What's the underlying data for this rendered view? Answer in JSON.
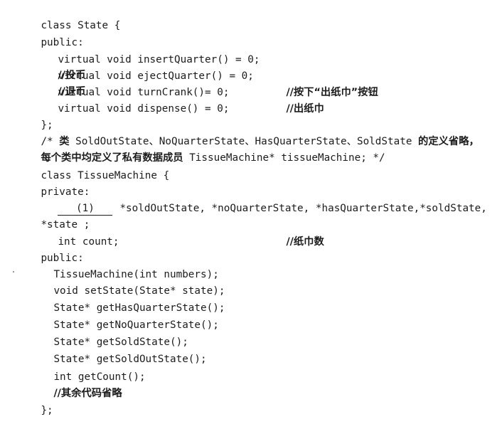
{
  "code": {
    "l01": "class State {",
    "l02": "public:",
    "l03_code": "virtual void insertQuarter() = 0;",
    "l03_comment": "//投币",
    "l04_code": "virtual void ejectQuarter() = 0;",
    "l04_comment": "//退币",
    "l05_code": "virtual void turnCrank()= 0;",
    "l05_comment": "//按下“出纸巾”按钮",
    "l06_code": "virtual void dispense() = 0;",
    "l06_comment": "//出纸巾",
    "l07": "};",
    "l08_a": "/* ",
    "l08_b": "类",
    "l08_c": " SoldOutState、NoQuarterState、HasQuarterState、SoldState ",
    "l08_d": "的定义省略，",
    "l09_a": "每个类中均定义了私有数据成员",
    "l09_b": " TissueMachine* tissueMachine; */",
    "l10": "class TissueMachine {",
    "l11": "private:",
    "l12_blank": "(1)",
    "l12_rest": "*soldOutState, *noQuarterState, *hasQuarterState,*soldState,",
    "l13": "*state ;",
    "l14_code": "int count;",
    "l14_comment": "//纸巾数",
    "l15": "public:",
    "l16": "TissueMachine(int numbers);",
    "l17": "void setState(State* state);",
    "l18": "State* getHasQuarterState();",
    "l19": "State* getNoQuarterState();",
    "l20": "State* getSoldState();",
    "l21": "State* getSoldOutState();",
    "l22": "int getCount();",
    "l23": "//其余代码省略",
    "l24": "};"
  }
}
